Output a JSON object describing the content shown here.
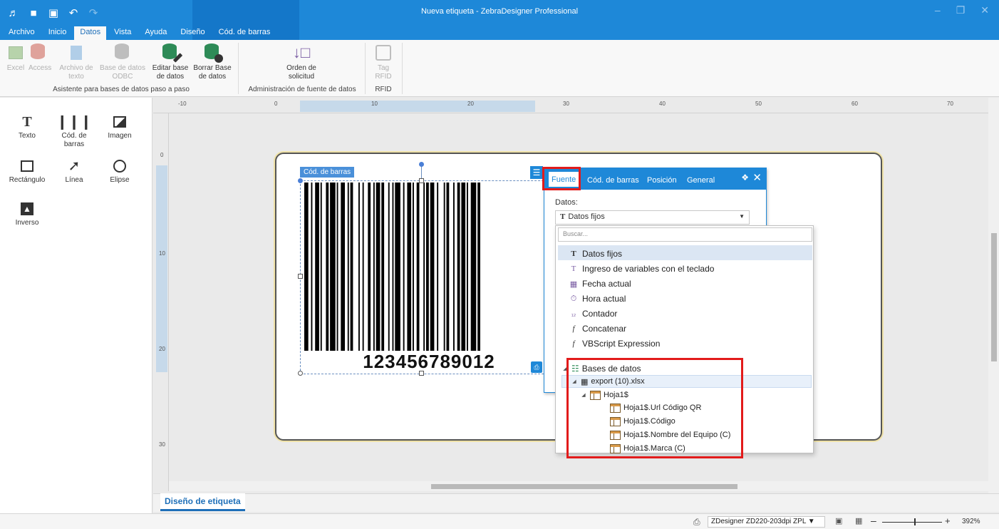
{
  "app": {
    "title": "Nueva etiqueta - ZebraDesigner Professional",
    "tabs": [
      "Archivo",
      "Inicio",
      "Datos",
      "Vista",
      "Ayuda",
      "Diseño",
      "Cód. de barras"
    ],
    "active_tab": "Datos"
  },
  "ribbon": {
    "buttons": [
      {
        "label": "Excel",
        "enabled": false
      },
      {
        "label": "Access",
        "enabled": false
      },
      {
        "label": "Archivo de texto",
        "enabled": false
      },
      {
        "label": "Base de datos ODBC",
        "enabled": false
      },
      {
        "label": "Editar base de datos",
        "enabled": true
      },
      {
        "label": "Borrar Base de datos",
        "enabled": true
      },
      {
        "label": "Orden de solicitud",
        "enabled": true
      },
      {
        "label": "Tag RFID",
        "enabled": false
      }
    ],
    "groups": [
      "Asistente para bases de datos paso a paso",
      "Administración de fuente de datos",
      "RFID"
    ]
  },
  "toolbox": [
    {
      "label": "Texto",
      "icon": "text-tool-icon"
    },
    {
      "label": "Cód. de barras",
      "icon": "barcode-tool-icon"
    },
    {
      "label": "Imagen",
      "icon": "image-tool-icon"
    },
    {
      "label": "Rectángulo",
      "icon": "rectangle-tool-icon"
    },
    {
      "label": "Línea",
      "icon": "line-tool-icon"
    },
    {
      "label": "Elipse",
      "icon": "ellipse-tool-icon"
    },
    {
      "label": "Inverso",
      "icon": "inverse-tool-icon"
    }
  ],
  "rulers": {
    "top": [
      "-10",
      "0",
      "10",
      "20",
      "30",
      "40",
      "50",
      "60",
      "70"
    ],
    "left": [
      "0",
      "10",
      "20",
      "30"
    ]
  },
  "canvas": {
    "barcode_tag": "Cód. de barras",
    "barcode_value": "123456789012"
  },
  "properties": {
    "tabs": [
      "Fuente",
      "Cód. de barras",
      "Posición",
      "General"
    ],
    "active_tab": "Fuente",
    "datos_label": "Datos:",
    "datos_value": "Datos fijos"
  },
  "dropdown": {
    "search_placeholder": "Buscar...",
    "items": [
      {
        "label": "Datos fijos",
        "icon": "fixed-data-icon",
        "selected": true
      },
      {
        "label": "Ingreso de variables con el teclado",
        "icon": "keyboard-input-icon",
        "selected": false
      },
      {
        "label": "Fecha actual",
        "icon": "current-date-icon",
        "selected": false
      },
      {
        "label": "Hora actual",
        "icon": "current-time-icon",
        "selected": false
      },
      {
        "label": "Contador",
        "icon": "counter-icon",
        "selected": false
      },
      {
        "label": "Concatenar",
        "icon": "function-icon",
        "selected": false
      },
      {
        "label": "VBScript Expression",
        "icon": "function-icon",
        "selected": false
      }
    ],
    "tree": {
      "root": "Bases de datos",
      "file": "export (10).xlsx",
      "sheet": "Hoja1$",
      "fields": [
        "Hoja1$.Url Código QR",
        "Hoja1$.Código",
        "Hoja1$.Nombre del Equipo (C)",
        "Hoja1$.Marca (C)"
      ]
    }
  },
  "bottom": {
    "doc_tab": "Diseño de etiqueta",
    "printer": "ZDesigner ZD220-203dpi ZPL",
    "zoom": "392%",
    "zoom_fraction": 0.54
  },
  "colors": {
    "accent": "#1e88d8",
    "highlight_red": "#e21b1b"
  }
}
